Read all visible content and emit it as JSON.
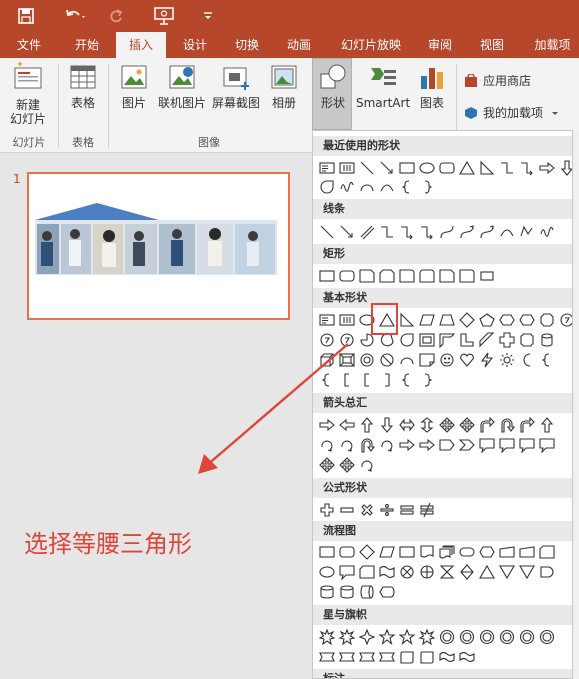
{
  "tabs": [
    "文件",
    "开始",
    "插入",
    "设计",
    "切换",
    "动画",
    "幻灯片放映",
    "审阅",
    "视图",
    "加载项"
  ],
  "ribbon": {
    "new_slide": "新建\n幻灯片",
    "table": "表格",
    "picture": "图片",
    "online_picture": "联机图片",
    "screenshot": "屏幕截图",
    "album": "相册",
    "shapes": "形状",
    "smartart": "SmartArt",
    "chart": "图表",
    "app_store": "应用商店",
    "my_addins": "我的加载项",
    "groups": [
      "幻灯片",
      "表格",
      "图像"
    ]
  },
  "slide_number": "1",
  "dropdown": {
    "sections": [
      "最近使用的形状",
      "线条",
      "矩形",
      "基本形状",
      "箭头总汇",
      "公式形状",
      "流程图",
      "星与旗帜",
      "标注"
    ]
  },
  "caption": "选择等腰三角形",
  "colors": {
    "accent": "#b7472a",
    "highlight": "#e0453a"
  }
}
